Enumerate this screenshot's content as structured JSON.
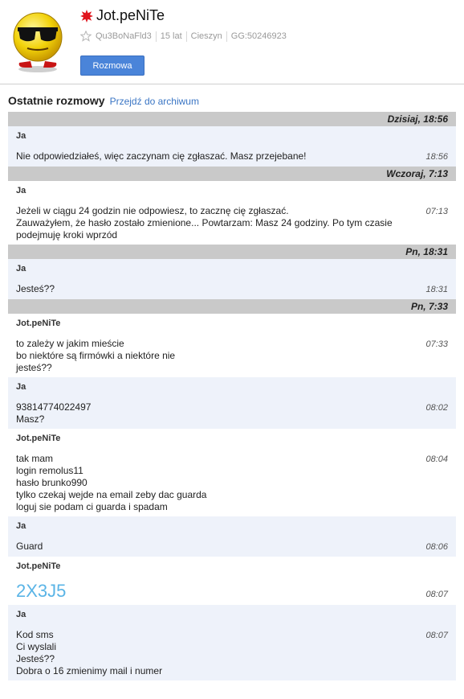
{
  "profile": {
    "name": "Jot.peNiTe",
    "meta": [
      "Qu3BoNaFld3",
      "15 lat",
      "Cieszyn",
      "GG:50246923"
    ],
    "button_label": "Rozmowa"
  },
  "section": {
    "title": "Ostatnie rozmowy",
    "archive_link": "Przejdź do archiwum"
  },
  "groups": [
    {
      "date": "Dzisiaj, 18:56",
      "messages": [
        {
          "author": "Ja",
          "time": "18:56",
          "lines": [
            "Nie odpowiedziałeś, więc zaczynam cię zgłaszać. Masz przejebane!"
          ]
        }
      ]
    },
    {
      "date": "Wczoraj, 7:13",
      "messages": [
        {
          "author": "Ja",
          "time": "07:13",
          "lines": [
            "Jeżeli w ciągu 24 godzin nie odpowiesz, to zacznę cię zgłaszać.",
            "Zauważyłem, że hasło zostało zmienione... Powtarzam: Masz 24 godziny. Po tym czasie",
            "podejmuję kroki wprzód"
          ]
        }
      ]
    },
    {
      "date": "Pn, 18:31",
      "messages": [
        {
          "author": "Ja",
          "time": "18:31",
          "lines": [
            "Jesteś??"
          ]
        }
      ]
    },
    {
      "date": "Pn, 7:33",
      "messages": [
        {
          "author": "Jot.peNiTe",
          "time": "07:33",
          "lines": [
            "to zależy w jakim mieście",
            "bo niektóre są firmówki a niektóre nie",
            "jesteś??"
          ]
        },
        {
          "author": "Ja",
          "time": "08:02",
          "lines": [
            "93814774022497",
            "Masz?"
          ]
        },
        {
          "author": "Jot.peNiTe",
          "time": "08:04",
          "lines": [
            "tak mam",
            "login remolus11",
            "hasło brunko990",
            "tylko czekaj wejde na email zeby dac guarda",
            "loguj sie podam ci guarda i spadam"
          ]
        },
        {
          "author": "Ja",
          "time": "08:06",
          "lines": [
            "Guard"
          ]
        },
        {
          "author": "Jot.peNiTe",
          "time": "08:07",
          "big": true,
          "lines": [
            "2X3J5"
          ]
        },
        {
          "author": "Ja",
          "time": "08:07",
          "lines": [
            "Kod sms",
            "Ci wyslali",
            "Jesteś??",
            "Dobra o 16 zmienimy mail i numer"
          ]
        }
      ]
    }
  ]
}
